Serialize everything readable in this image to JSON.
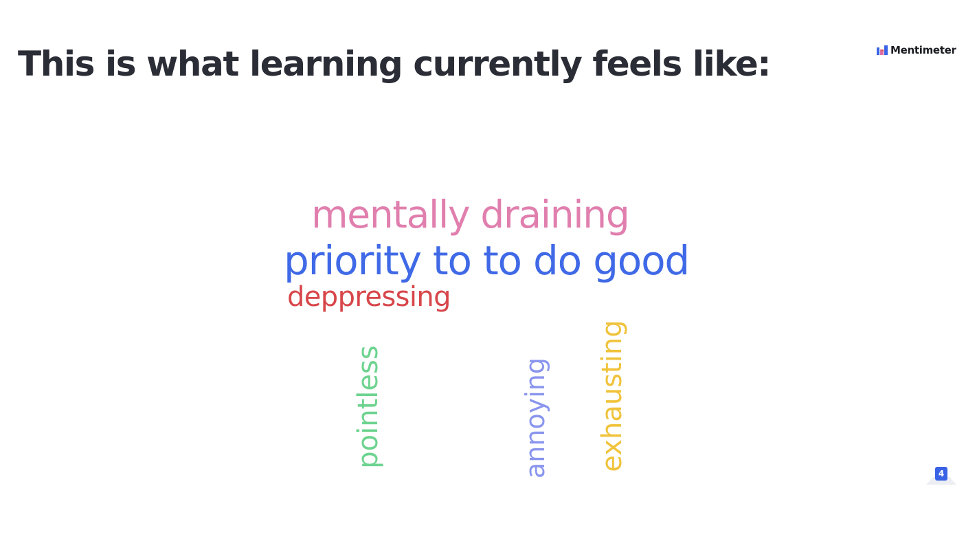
{
  "slide": {
    "question": "This is what learning currently feels like:",
    "background_color": "#ffffff",
    "title_color": "#2b2d36"
  },
  "brand": {
    "name": "Mentimeter",
    "logo_icon": "mentimeter-logo-icon",
    "logo_colors": [
      "#3a62e6",
      "#e070a8",
      "#d94f55"
    ]
  },
  "word_cloud": {
    "words": [
      {
        "text": "mentally draining",
        "color": "#e07fae",
        "orientation": "horizontal"
      },
      {
        "text": "priority to to do good",
        "color": "#3f69e6",
        "orientation": "horizontal"
      },
      {
        "text": "deppressing",
        "color": "#d7464a",
        "orientation": "horizontal"
      },
      {
        "text": "pointless",
        "color": "#6dd38f",
        "orientation": "vertical"
      },
      {
        "text": "annoying",
        "color": "#8a95ee",
        "orientation": "vertical"
      },
      {
        "text": "exhausting",
        "color": "#f0c33c",
        "orientation": "vertical"
      }
    ]
  },
  "response_counter": {
    "count": "4",
    "badge_color": "#3a62e6"
  }
}
